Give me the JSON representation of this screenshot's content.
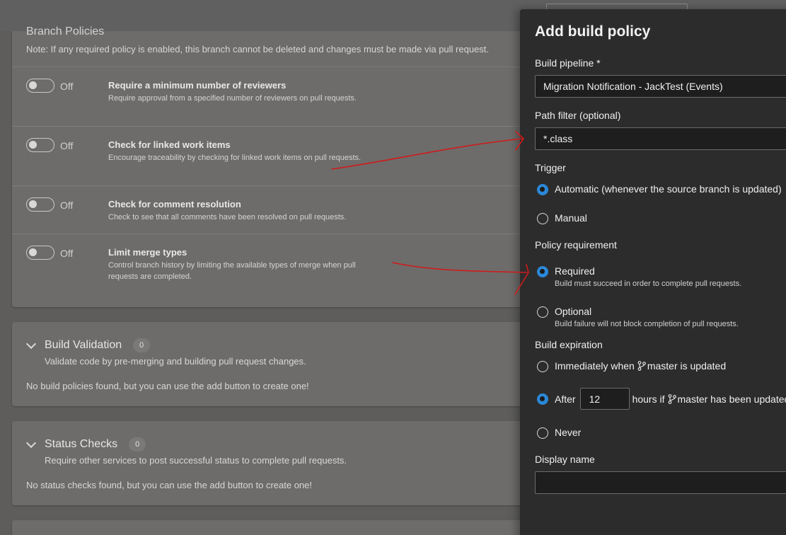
{
  "page": {
    "section_title": "Branch Policies",
    "section_note": "Note: If any required policy is enabled, this branch cannot be deleted and changes must be made via pull request."
  },
  "policies": [
    {
      "toggle_state": "Off",
      "title": "Require a minimum number of reviewers",
      "description": "Require approval from a specified number of reviewers on pull requests."
    },
    {
      "toggle_state": "Off",
      "title": "Check for linked work items",
      "description": "Encourage traceability by checking for linked work items on pull requests."
    },
    {
      "toggle_state": "Off",
      "title": "Check for comment resolution",
      "description": "Check to see that all comments have been resolved on pull requests."
    },
    {
      "toggle_state": "Off",
      "title": "Limit merge types",
      "description": "Control branch history by limiting the available types of merge when pull requests are completed."
    }
  ],
  "build_validation": {
    "title": "Build Validation",
    "count": "0",
    "description": "Validate code by pre-merging and building pull request changes.",
    "empty": "No build policies found, but you can use the add button to create one!"
  },
  "status_checks": {
    "title": "Status Checks",
    "count": "0",
    "description": "Require other services to post successful status to complete pull requests.",
    "empty": "No status checks found, but you can use the add button to create one!"
  },
  "panel": {
    "title": "Add build policy",
    "build_pipeline_label": "Build pipeline *",
    "build_pipeline_value": "Migration Notification - JackTest (Events)",
    "path_filter_label": "Path filter (optional)",
    "path_filter_value": "*.class",
    "trigger_label": "Trigger",
    "trigger_automatic": "Automatic (whenever the source branch is updated)",
    "trigger_manual": "Manual",
    "policy_requirement_label": "Policy requirement",
    "required_label": "Required",
    "required_sub": "Build must succeed in order to complete pull requests.",
    "optional_label": "Optional",
    "optional_sub": "Build failure will not block completion of pull requests.",
    "build_expiration_label": "Build expiration",
    "exp_immediately_prefix": "Immediately when",
    "exp_immediately_branch": "master is updated",
    "exp_after_prefix": "After",
    "exp_after_hours": "12",
    "exp_after_suffix": "hours if",
    "exp_after_branch": "master has been updated",
    "exp_never": "Never",
    "display_name_label": "Display name",
    "display_name_value": ""
  },
  "colors": {
    "accent": "#2b88d8",
    "annotation": "#d11a1a"
  }
}
